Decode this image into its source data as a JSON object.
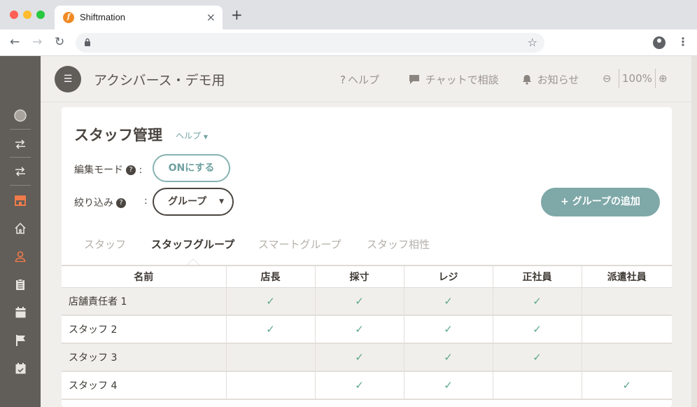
{
  "browser": {
    "tab_title": "Shiftmation",
    "tab_favicon": "f",
    "tab_close": "×",
    "new_tab": "+",
    "back": "←",
    "forward": "→",
    "reload": "↻",
    "lock": "🔒",
    "star": "☆",
    "menu": "⋮"
  },
  "header": {
    "menu_icon": "☰",
    "org_title": "アクシバース・デモ用",
    "help": "ヘルプ",
    "chat": "チャットで相談",
    "notifications": "お知らせ",
    "zoom_level": "100%",
    "zoom_out": "⊖",
    "zoom_in": "⊕"
  },
  "sidebar": {
    "items": [
      {
        "icon": "logo-icon"
      },
      {
        "icon": "swap-icon"
      },
      {
        "icon": "swap-icon"
      },
      {
        "icon": "store-icon",
        "active": true
      },
      {
        "icon": "home-icon"
      },
      {
        "icon": "user-icon",
        "active": true
      },
      {
        "icon": "clipboard-icon"
      },
      {
        "icon": "calendar-icon"
      },
      {
        "icon": "flag-icon"
      },
      {
        "icon": "calendar-check-icon"
      }
    ]
  },
  "page": {
    "title": "スタッフ管理",
    "help_link": "ヘルプ",
    "edit_mode_label": "編集モード",
    "edit_mode_button": "ONにする",
    "filter_label": "絞り込み",
    "filter_value": "グループ",
    "add_group_button": "+ グループの追加",
    "subtabs": [
      "スタッフ",
      "スタッフグループ",
      "スマートグループ",
      "スタッフ相性"
    ],
    "active_subtab": "スタッフグループ"
  },
  "table": {
    "columns": [
      "名前",
      "店長",
      "採寸",
      "レジ",
      "正社員",
      "派遣社員"
    ],
    "rows": [
      {
        "name": "店舗責任者 1",
        "checks": [
          true,
          true,
          true,
          true,
          false
        ]
      },
      {
        "name": "スタッフ 2",
        "checks": [
          true,
          true,
          true,
          true,
          false
        ]
      },
      {
        "name": "スタッフ 3",
        "checks": [
          false,
          true,
          true,
          true,
          false
        ]
      },
      {
        "name": "スタッフ 4",
        "checks": [
          false,
          true,
          true,
          false,
          true
        ]
      }
    ],
    "check_glyph": "✓"
  },
  "colors": {
    "sidebar_bg": "#615d58",
    "accent_orange": "#ef7b4b",
    "teal": "#7fa8a8",
    "check_green": "#5da88a"
  }
}
